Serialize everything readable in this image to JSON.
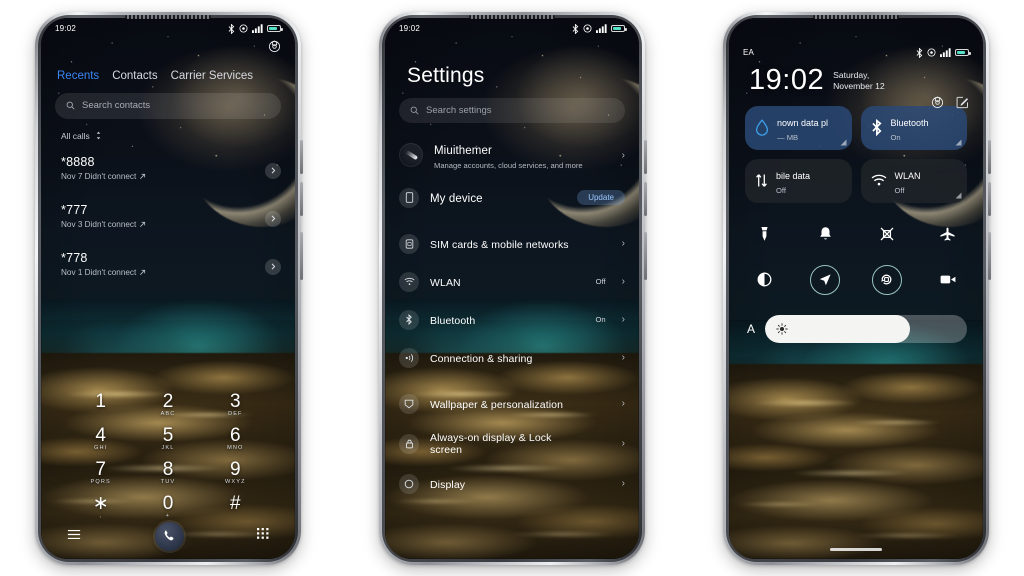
{
  "screens": {
    "dialer": {
      "status": {
        "time": "19:02",
        "icons": [
          "bluetooth-icon",
          "alarm-icon",
          "signal-icon",
          "battery-icon"
        ]
      },
      "settings_icon": "gear-icon",
      "tabs": [
        {
          "label": "Recents",
          "active": true
        },
        {
          "label": "Contacts",
          "active": false
        },
        {
          "label": "Carrier Services",
          "active": false
        }
      ],
      "search": {
        "placeholder": "Search contacts",
        "icon": "search-icon"
      },
      "filter": {
        "label": "All calls",
        "icon": "sort-icon"
      },
      "calls": [
        {
          "number": "*8888",
          "detail": "Nov 7 Didn't connect",
          "direction": "outgoing"
        },
        {
          "number": "*777",
          "detail": "Nov 3 Didn't connect",
          "direction": "outgoing"
        },
        {
          "number": "*778",
          "detail": "Nov 1 Didn't connect",
          "direction": "outgoing"
        }
      ],
      "keypad": [
        {
          "digit": "1",
          "letters": ""
        },
        {
          "digit": "2",
          "letters": "ABC"
        },
        {
          "digit": "3",
          "letters": "DEF"
        },
        {
          "digit": "4",
          "letters": "GHI"
        },
        {
          "digit": "5",
          "letters": "JKL"
        },
        {
          "digit": "6",
          "letters": "MNO"
        },
        {
          "digit": "7",
          "letters": "PQRS"
        },
        {
          "digit": "8",
          "letters": "TUV"
        },
        {
          "digit": "9",
          "letters": "WXYZ"
        },
        {
          "digit": "∗",
          "letters": ","
        },
        {
          "digit": "0",
          "letters": "+"
        },
        {
          "digit": "#",
          "letters": ""
        }
      ],
      "bottom": {
        "menu": "menu-icon",
        "call": "call-icon",
        "keypad": "dialpad-icon"
      }
    },
    "settings": {
      "status": {
        "time": "19:02"
      },
      "title": "Settings",
      "search": {
        "placeholder": "Search settings",
        "icon": "search-icon"
      },
      "account": {
        "name": "Miuithemer",
        "desc": "Manage accounts, cloud services, and more",
        "icon": "account-avatar"
      },
      "device": {
        "name": "My device",
        "badge": "Update",
        "icon": "phone-icon"
      },
      "items": [
        {
          "name": "SIM cards & mobile networks",
          "value": "",
          "icon": "sim-icon"
        },
        {
          "name": "WLAN",
          "value": "Off",
          "icon": "wifi-icon"
        },
        {
          "name": "Bluetooth",
          "value": "On",
          "icon": "bluetooth-icon"
        },
        {
          "name": "Connection & sharing",
          "value": "",
          "icon": "share-icon"
        },
        {
          "name": "Wallpaper & personalization",
          "value": "",
          "icon": "wallpaper-icon"
        },
        {
          "name": "Always-on display & Lock screen",
          "value": "",
          "icon": "lock-icon"
        },
        {
          "name": "Display",
          "value": "",
          "icon": "display-icon"
        }
      ]
    },
    "controlcenter": {
      "status": {
        "carrier": "EA",
        "icons": [
          "bluetooth-icon",
          "alarm-icon",
          "signal-icon",
          "battery-icon"
        ]
      },
      "clock": "19:02",
      "date": "Saturday, November 12",
      "actions": [
        "gear-icon",
        "edit-icon"
      ],
      "tiles": [
        {
          "title": "nown data pl",
          "sub": "— MB",
          "icon": "data-drop-icon",
          "state": "on"
        },
        {
          "title": "Bluetooth",
          "sub": "On",
          "icon": "bluetooth-icon",
          "state": "on"
        },
        {
          "title": "bile data",
          "sub": "Off",
          "icon": "mobile-data-icon",
          "state": "off"
        },
        {
          "title": "WLAN",
          "sub": "Off",
          "icon": "wifi-icon",
          "state": "off"
        }
      ],
      "toggles_row1": [
        {
          "icon": "flashlight-icon",
          "active": false
        },
        {
          "icon": "ringer-bell-icon",
          "active": false
        },
        {
          "icon": "screenshot-icon",
          "active": false
        },
        {
          "icon": "airplane-icon",
          "active": false
        }
      ],
      "toggles_row2": [
        {
          "icon": "dark-mode-icon",
          "active": false
        },
        {
          "icon": "location-icon",
          "active": true
        },
        {
          "icon": "auto-rotate-icon",
          "active": true
        },
        {
          "icon": "screen-recorder-icon",
          "active": false
        }
      ],
      "brightness": {
        "auto_label": "A",
        "icon": "brightness-sun-icon",
        "percent": 72
      }
    }
  },
  "colors": {
    "accent_blue": "#3b86f7",
    "tile_on": "#2a4874",
    "tile_off": "#20242a",
    "battery": "#57e0c8",
    "ring_active": "#aad7d4"
  }
}
